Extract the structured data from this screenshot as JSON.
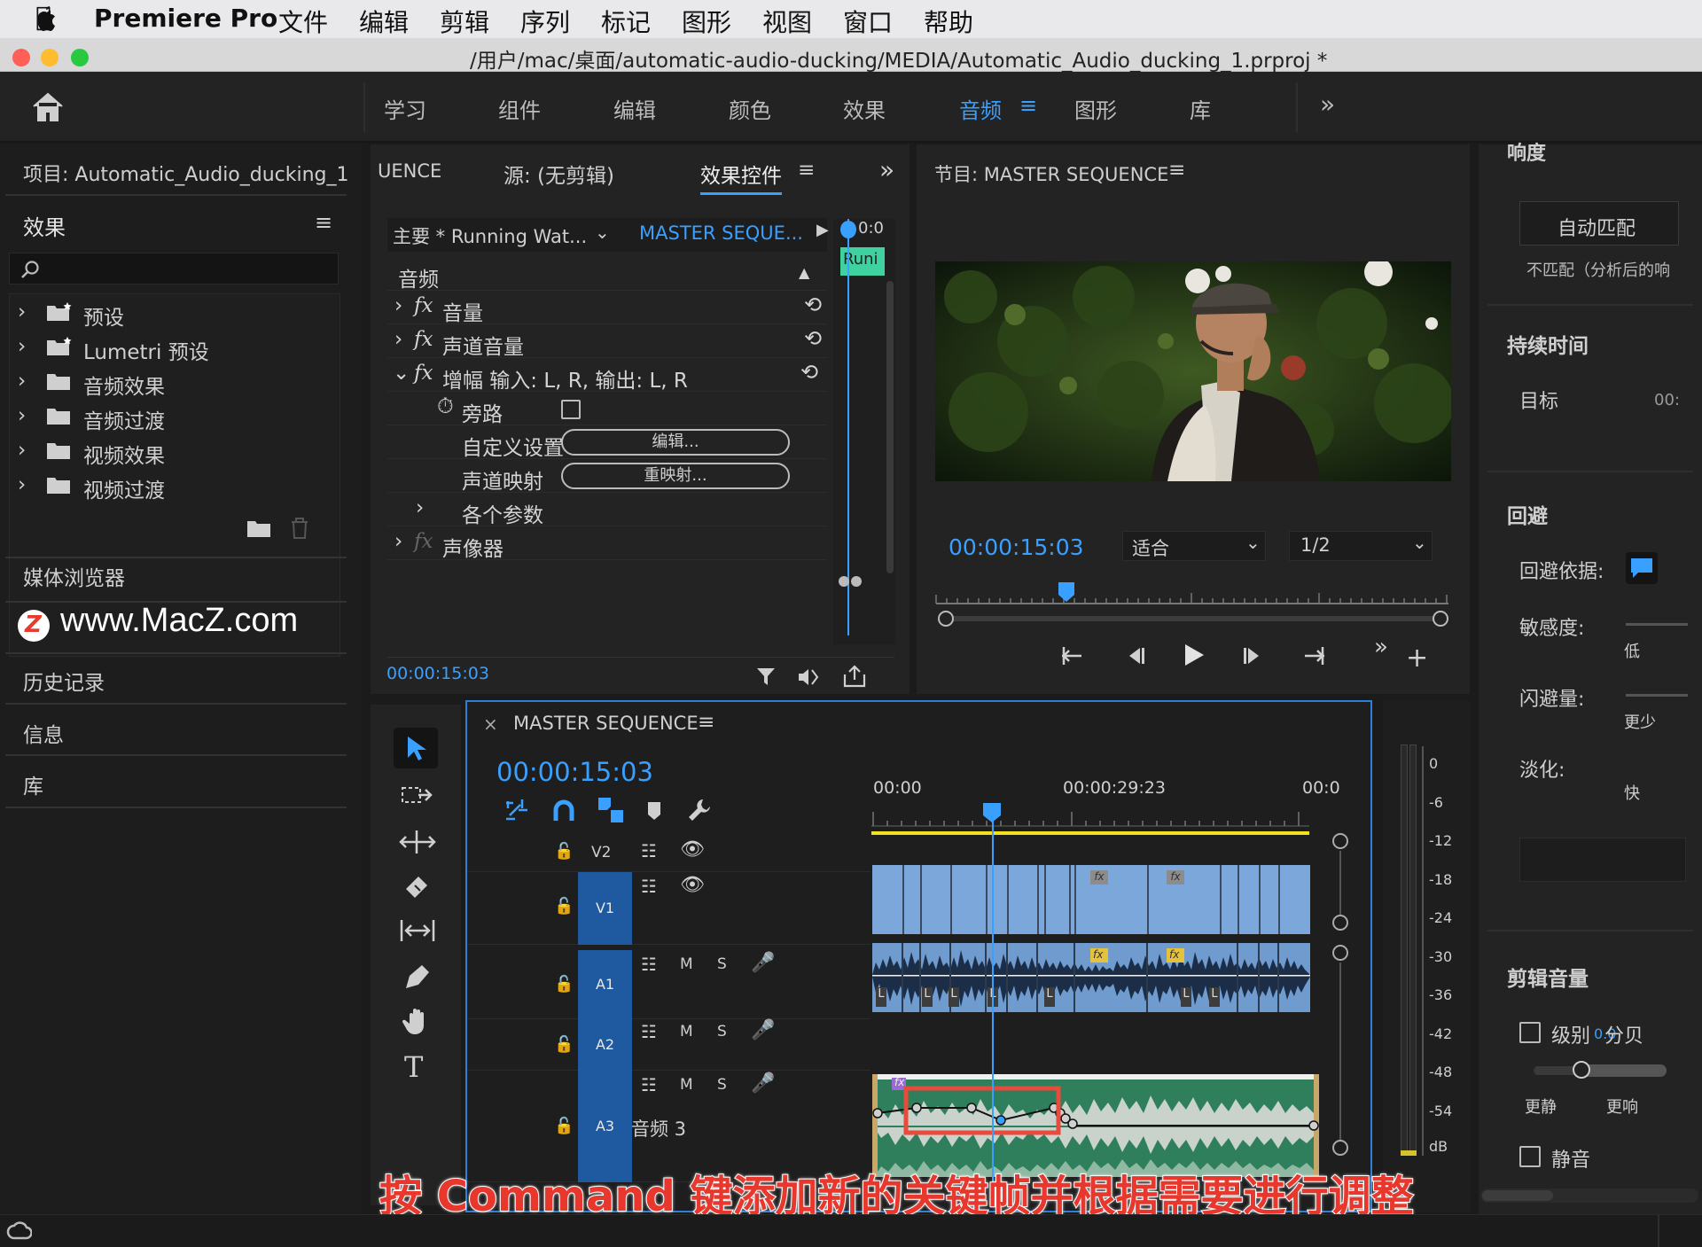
{
  "menubar": {
    "app_name": "Premiere Pro",
    "items": [
      "文件",
      "编辑",
      "剪辑",
      "序列",
      "标记",
      "图形",
      "视图",
      "窗口",
      "帮助"
    ]
  },
  "window": {
    "title": "/用户/mac/桌面/automatic-audio-ducking/MEDIA/Automatic_Audio_ducking_1.prproj *"
  },
  "workspaces": {
    "items": [
      "学习",
      "组件",
      "编辑",
      "颜色",
      "效果",
      "音频",
      "图形",
      "库"
    ],
    "active": "音频"
  },
  "project_panel": {
    "title": "项目: Automatic_Audio_ducking_1",
    "effects_title": "效果",
    "tree": [
      "预设",
      "Lumetri 预设",
      "音频效果",
      "音频过渡",
      "视频效果",
      "视频过渡"
    ],
    "media_browser": "媒体浏览器",
    "watermark": "www.MacZ.com",
    "history": "历史记录",
    "info": "信息",
    "library": "库"
  },
  "effect_controls": {
    "tab_sequence": "UENCE",
    "tab_source": "源: (无剪辑)",
    "tab_active": "效果控件",
    "master_clip": "主要 * Running Wat...",
    "sequence_clip": "MASTER SEQUE...",
    "mini_clip": "Runi",
    "mini_time": "0:0",
    "section": "音频",
    "rows": {
      "volume": "音量",
      "channel_volume": "声道音量",
      "amplify": "增幅 输入: L, R,  输出: L, R",
      "bypass": "旁路",
      "custom_setup": "自定义设置",
      "edit_btn": "编辑...",
      "channel_map": "声道映射",
      "remap_btn": "重映射...",
      "params": "各个参数",
      "panner": "声像器"
    },
    "timecode": "00:00:15:03"
  },
  "program_monitor": {
    "title": "节目: MASTER SEQUENCE",
    "timecode": "00:00:15:03",
    "zoom": "适合",
    "resolution": "1/2"
  },
  "timeline": {
    "title": "MASTER SEQUENCE",
    "timecode": "00:00:15:03",
    "ruler": [
      "00:00",
      "00:00:29:23",
      "00:0"
    ],
    "tracks": [
      "V2",
      "V1",
      "A1",
      "A2",
      "A3"
    ],
    "track_name_a3": "音频 3",
    "m": "M",
    "s": "S",
    "fx": "fx",
    "clip_l": "L"
  },
  "meter": {
    "labels": [
      "0",
      "-6",
      "-12",
      "-18",
      "-24",
      "-30",
      "-36",
      "-42",
      "-48",
      "-54",
      "dB"
    ]
  },
  "essential_sound": {
    "cut_label": "响度",
    "auto_match": "自动匹配",
    "unmatched": "不匹配（分析后的响",
    "duration": "持续时间",
    "target": "目标",
    "target_val": "00:",
    "ducking": "回避",
    "duck_against": "回避依据:",
    "sensitivity": "敏感度:",
    "sens_val": "低",
    "duck_amount": "闪避量:",
    "amount_val": "更少",
    "fade": "淡化:",
    "fade_val": "快",
    "clip_volume": "剪辑音量",
    "level": "级别",
    "db": "分贝",
    "quieter": "更静",
    "louder": "更响",
    "mute": "静音"
  },
  "caption": "按 Command 键添加新的关键帧并根据需要进行调整"
}
